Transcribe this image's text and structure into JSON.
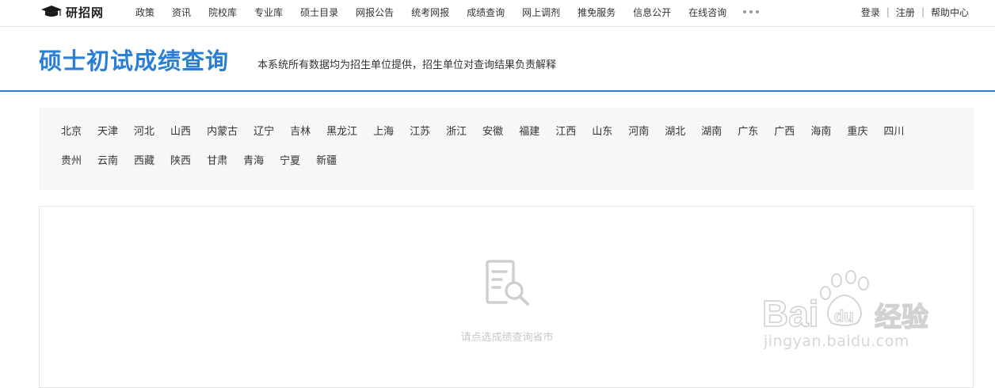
{
  "site": {
    "logo_text": "研招网"
  },
  "nav": {
    "items": [
      "政策",
      "资讯",
      "院校库",
      "专业库",
      "硕士目录",
      "网报公告",
      "统考网报",
      "成绩查询",
      "网上调剂",
      "推免服务",
      "信息公开",
      "在线咨询"
    ]
  },
  "user_links": {
    "login": "登录",
    "separator": "|",
    "register": "注册",
    "help": "帮助中心"
  },
  "header": {
    "title": "硕士初试成绩查询",
    "subtitle": "本系统所有数据均为招生单位提供，招生单位对查询结果负责解释"
  },
  "provinces": {
    "row1": [
      "北京",
      "天津",
      "河北",
      "山西",
      "内蒙古",
      "辽宁",
      "吉林",
      "黑龙江",
      "上海",
      "江苏",
      "浙江",
      "安徽",
      "福建",
      "江西",
      "山东",
      "河南",
      "湖北",
      "湖南",
      "广东",
      "广西",
      "海南",
      "重庆",
      "四川"
    ],
    "row2": [
      "贵州",
      "云南",
      "西藏",
      "陕西",
      "甘肃",
      "青海",
      "宁夏",
      "新疆"
    ]
  },
  "results": {
    "empty_text": "请点选成绩查询省市"
  },
  "watermark": {
    "brand": "Baidu经验",
    "url": "jingyan.baidu.com"
  },
  "colors": {
    "accent": "#2a7fd4",
    "panel_bg": "#f6f7f9",
    "muted_text": "#c8c8c8"
  }
}
